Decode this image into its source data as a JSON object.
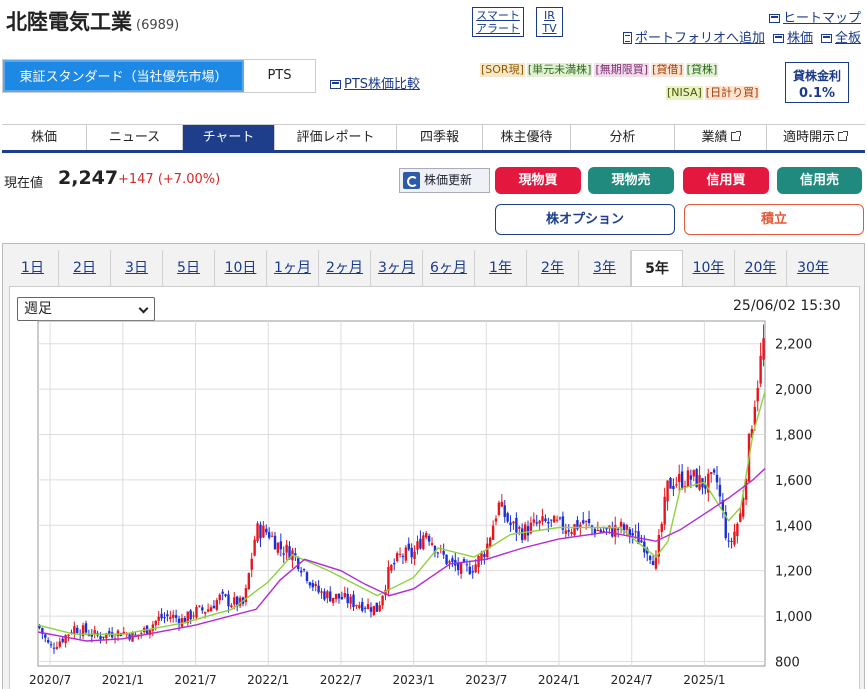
{
  "header": {
    "company_name": "北陸電気工業",
    "code": "(6989)",
    "smart_alert_line1": "スマート",
    "smart_alert_line2": "アラート",
    "irtv_line1": "IR",
    "irtv_line2": "TV",
    "heatmap_label": "ヒートマップ",
    "portfolio_label": "ポートフォリオへ追加",
    "stock_price_label": "株価",
    "full_board_label": "全板"
  },
  "market": {
    "selected": "東証スタンダード（当社優先市場）",
    "pts": "PTS",
    "pts_compare": "PTS株価比較"
  },
  "badges": {
    "row1": [
      "[SOR現]",
      "[単元未満株]",
      "[無期限買]",
      "[貸借]",
      "[貸株]"
    ],
    "row2": [
      "[NISA]",
      "[日計り買]"
    ]
  },
  "lending": {
    "label": "貸株金利",
    "rate": "0.1%"
  },
  "nav": {
    "tabs": [
      "株価",
      "ニュース",
      "チャート",
      "評価レポート",
      "四季報",
      "株主優待",
      "分析",
      "業績",
      "適時開示"
    ],
    "active": "チャート"
  },
  "price": {
    "label": "現在値",
    "value": "2,247",
    "change": "+147 (+7.00%)"
  },
  "actions": {
    "refresh": "株価更新",
    "cash_buy": "現物買",
    "cash_sell": "現物売",
    "margin_buy": "信用買",
    "margin_sell": "信用売",
    "stock_option": "株オプション",
    "accumulate": "積立"
  },
  "periods": {
    "items": [
      "1日",
      "2日",
      "3日",
      "5日",
      "10日",
      "1ヶ月",
      "2ヶ月",
      "3ヶ月",
      "6ヶ月",
      "1年",
      "2年",
      "3年",
      "5年",
      "10年",
      "20年",
      "30年"
    ],
    "active": "5年"
  },
  "chart_controls": {
    "frequency": "週足",
    "timestamp": "25/06/02 15:30"
  },
  "colors": {
    "up_candle": "#e8141e",
    "down_candle": "#1a2fd6",
    "ma_short": "#8fd13f",
    "ma_long": "#b12ad6",
    "accent": "#1e3d8a"
  },
  "chart_data": {
    "type": "candlestick",
    "title": "",
    "xlabel": "",
    "ylabel": "",
    "x_ticks": [
      "2020/7",
      "2021/1",
      "2021/7",
      "2022/1",
      "2022/7",
      "2023/1",
      "2023/7",
      "2024/1",
      "2024/7",
      "2025/1"
    ],
    "y_ticks": [
      800,
      1000,
      1200,
      1400,
      1600,
      1800,
      2000,
      2200
    ],
    "y_tick_labels": [
      "800",
      "1,000",
      "1,200",
      "1,400",
      "1,600",
      "1,800",
      "2,000",
      "2,200"
    ],
    "ylim": [
      780,
      2300
    ],
    "xlim": [
      "2020/6",
      "2025/6"
    ],
    "grid": true,
    "series_close": [
      [
        "2020/6",
        960
      ],
      [
        "2020/7",
        860
      ],
      [
        "2020/8",
        900
      ],
      [
        "2020/9",
        950
      ],
      [
        "2020/10",
        930
      ],
      [
        "2020/11",
        910
      ],
      [
        "2020/12",
        925
      ],
      [
        "2021/1",
        930
      ],
      [
        "2021/2",
        910
      ],
      [
        "2021/3",
        945
      ],
      [
        "2021/4",
        990
      ],
      [
        "2021/5",
        1000
      ],
      [
        "2021/6",
        980
      ],
      [
        "2021/7",
        1020
      ],
      [
        "2021/8",
        1030
      ],
      [
        "2021/9",
        1080
      ],
      [
        "2021/10",
        1060
      ],
      [
        "2021/11",
        1050
      ],
      [
        "2021/12",
        1380
      ],
      [
        "2022/1",
        1370
      ],
      [
        "2022/2",
        1300
      ],
      [
        "2022/3",
        1280
      ],
      [
        "2022/4",
        1200
      ],
      [
        "2022/5",
        1110
      ],
      [
        "2022/6",
        1090
      ],
      [
        "2022/7",
        1080
      ],
      [
        "2022/8",
        1060
      ],
      [
        "2022/9",
        1050
      ],
      [
        "2022/10",
        1030
      ],
      [
        "2022/11",
        1200
      ],
      [
        "2022/12",
        1270
      ],
      [
        "2023/1",
        1270
      ],
      [
        "2023/2",
        1380
      ],
      [
        "2023/3",
        1290
      ],
      [
        "2023/4",
        1230
      ],
      [
        "2023/5",
        1200
      ],
      [
        "2023/6",
        1220
      ],
      [
        "2023/7",
        1300
      ],
      [
        "2023/8",
        1490
      ],
      [
        "2023/9",
        1400
      ],
      [
        "2023/10",
        1370
      ],
      [
        "2023/11",
        1400
      ],
      [
        "2023/12",
        1410
      ],
      [
        "2024/1",
        1400
      ],
      [
        "2024/2",
        1390
      ],
      [
        "2024/3",
        1410
      ],
      [
        "2024/4",
        1380
      ],
      [
        "2024/5",
        1370
      ],
      [
        "2024/6",
        1390
      ],
      [
        "2024/7",
        1360
      ],
      [
        "2024/8",
        1320
      ],
      [
        "2024/9",
        1240
      ],
      [
        "2024/10",
        1580
      ],
      [
        "2024/11",
        1600
      ],
      [
        "2024/12",
        1610
      ],
      [
        "2025/1",
        1580
      ],
      [
        "2025/2",
        1600
      ],
      [
        "2025/3",
        1300
      ],
      [
        "2025/4",
        1450
      ],
      [
        "2025/5",
        1900
      ],
      [
        "2025/6",
        2247
      ]
    ],
    "series": [
      {
        "values": [
          [
            "2020/6",
            960
          ],
          [
            "2020/9",
            920
          ],
          [
            "2021/1",
            920
          ],
          [
            "2021/6",
            970
          ],
          [
            "2021/10",
            1030
          ],
          [
            "2022/1",
            1150
          ],
          [
            "2022/3",
            1270
          ],
          [
            "2022/6",
            1200
          ],
          [
            "2022/10",
            1090
          ],
          [
            "2023/1",
            1170
          ],
          [
            "2023/3",
            1300
          ],
          [
            "2023/6",
            1260
          ],
          [
            "2023/9",
            1360
          ],
          [
            "2024/1",
            1390
          ],
          [
            "2024/6",
            1390
          ],
          [
            "2024/9",
            1260
          ],
          [
            "2024/10",
            1330
          ],
          [
            "2024/11",
            1560
          ],
          [
            "2025/1",
            1590
          ],
          [
            "2025/3",
            1420
          ],
          [
            "2025/4",
            1480
          ],
          [
            "2025/5",
            1800
          ],
          [
            "2025/6",
            1990
          ]
        ]
      },
      {
        "values": [
          [
            "2020/6",
            930
          ],
          [
            "2020/10",
            890
          ],
          [
            "2021/1",
            900
          ],
          [
            "2021/7",
            960
          ],
          [
            "2021/12",
            1030
          ],
          [
            "2022/2",
            1160
          ],
          [
            "2022/4",
            1250
          ],
          [
            "2022/7",
            1200
          ],
          [
            "2022/9",
            1140
          ],
          [
            "2022/11",
            1090
          ],
          [
            "2023/1",
            1120
          ],
          [
            "2023/4",
            1230
          ],
          [
            "2023/7",
            1250
          ],
          [
            "2023/10",
            1300
          ],
          [
            "2024/1",
            1340
          ],
          [
            "2024/5",
            1370
          ],
          [
            "2024/9",
            1330
          ],
          [
            "2024/11",
            1380
          ],
          [
            "2025/1",
            1450
          ],
          [
            "2025/3",
            1520
          ],
          [
            "2025/5",
            1600
          ],
          [
            "2025/6",
            1650
          ]
        ]
      }
    ]
  }
}
